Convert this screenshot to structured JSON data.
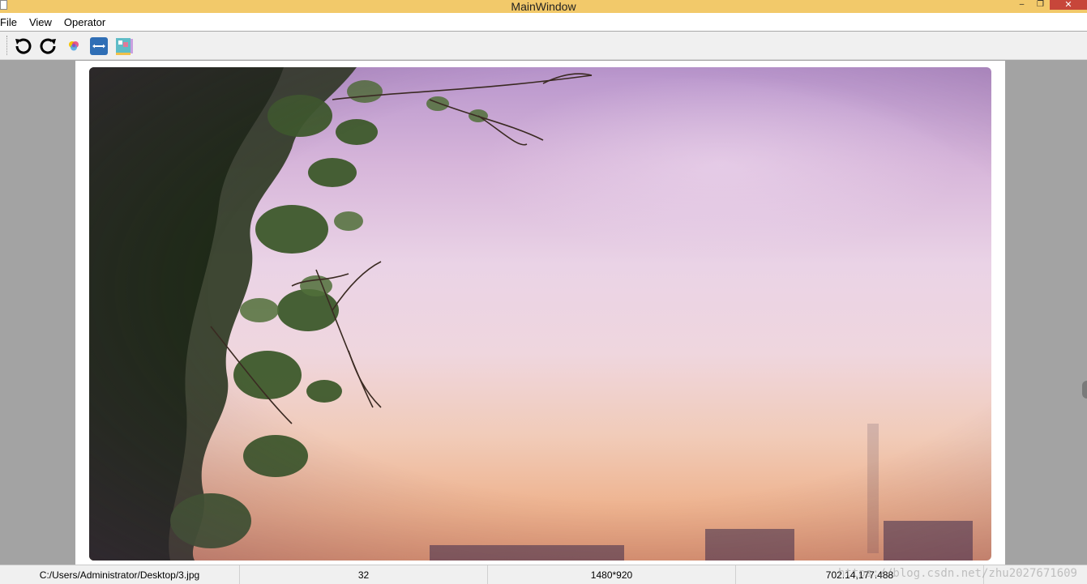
{
  "window": {
    "title": "MainWindow",
    "controls": {
      "minimize": "–",
      "maximize": "❐",
      "close": "✕"
    }
  },
  "menu": {
    "items": [
      "File",
      "View",
      "Operator"
    ]
  },
  "toolbar": {
    "buttons": [
      {
        "name": "rotate-left-button",
        "icon": "rotate-left-icon"
      },
      {
        "name": "rotate-right-button",
        "icon": "rotate-right-icon"
      },
      {
        "name": "color-button",
        "icon": "color-palette-icon"
      },
      {
        "name": "flip-horizontal-button",
        "icon": "flip-horizontal-icon"
      },
      {
        "name": "image-effect-button",
        "icon": "image-effect-icon"
      }
    ]
  },
  "status": {
    "path": "C:/Users/Administrator/Desktop/3.jpg",
    "depth": "32",
    "size": "1480*920",
    "coords": "702.14,177.488",
    "watermark": "https://blog.csdn.net/zhu2027671609"
  },
  "colors": {
    "titlebar": "#f2c96a",
    "close": "#c7463a",
    "background": "#a3a3a3"
  }
}
